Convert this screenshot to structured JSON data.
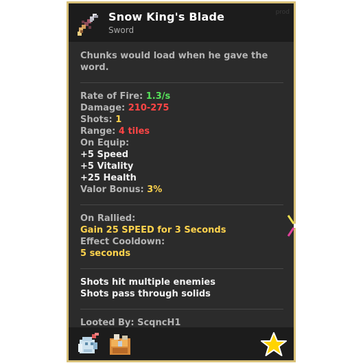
{
  "item": {
    "name": "Snow King's Blade",
    "type": "Sword",
    "watermark": "prod"
  },
  "description": "Chunks would load when he gave the word.",
  "stats": {
    "rate_of_fire_label": "Rate of Fire: ",
    "rate_of_fire_value": "1.3/s",
    "damage_label": "Damage: ",
    "damage_value": "210-275",
    "shots_label": "Shots: ",
    "shots_value": "1",
    "range_label": "Range: ",
    "range_value": "4 tiles",
    "on_equip_label": "On Equip:",
    "on_equip": [
      "+5 Speed",
      "+5 Vitality",
      "+25 Health"
    ],
    "valor_label": "Valor Bonus: ",
    "valor_value": "3%"
  },
  "ability": {
    "on_rallied_label": "On Rallied:",
    "on_rallied_value": "Gain 25 SPEED for 3 Seconds",
    "cooldown_label": "Effect Cooldown:",
    "cooldown_value": "5 seconds"
  },
  "properties": [
    "Shots hit multiple enemies",
    "Shots pass through solids"
  ],
  "looted_by": "Looted By: ScqncH1",
  "colors": {
    "border": "#d8c078",
    "panel": "#2b2b2b",
    "header": "#1c1c1c",
    "rate_of_fire": "#56e35a",
    "damage": "#ff4545",
    "highlight": "#ffd34d"
  },
  "icons": [
    "sword-icon",
    "soulbound-icon",
    "backpack-icon",
    "star-icon"
  ]
}
